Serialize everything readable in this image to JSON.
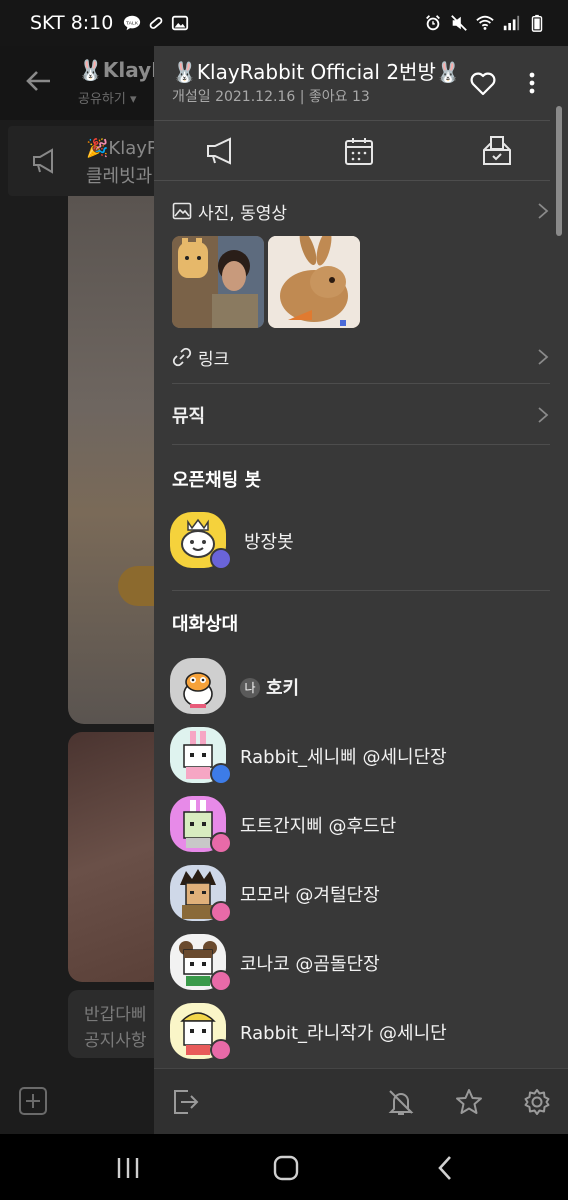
{
  "status_bar": {
    "carrier_time": "SKT 8:10",
    "talk_badge": "TALK"
  },
  "background_chat": {
    "title": "🐰KlayR",
    "share": "공유하기 ▾",
    "notice_line1": "🎉KlayR",
    "notice_line2": "클레빗과",
    "bubble_line1": "반갑다삐",
    "bubble_line2": "공지사항"
  },
  "drawer": {
    "room_title": "🐰KlayRabbit Official 2번방🐰",
    "room_meta": "개설일 2021.12.16 | 좋아요 13",
    "sections": {
      "media_label": "사진, 동영상",
      "link_label": "링크",
      "music_label": "뮤직",
      "bot_heading": "오픈채팅 봇",
      "members_heading": "대화상대"
    },
    "bot": {
      "name": "방장봇"
    },
    "members": [
      {
        "name": "호키",
        "me": "나",
        "badge_color": ""
      },
      {
        "name": "Rabbit_세니삐 @세니단장",
        "badge_color": "#3d7ce8"
      },
      {
        "name": "도트간지삐 @후드단",
        "badge_color": "#e86aa8"
      },
      {
        "name": "모모라 @겨털단장",
        "badge_color": "#e86aa8"
      },
      {
        "name": "코나코 @곰돌단장",
        "badge_color": "#e86aa8"
      },
      {
        "name": "Rabbit_라니작가 @세니단",
        "badge_color": "#e86aa8"
      }
    ]
  }
}
